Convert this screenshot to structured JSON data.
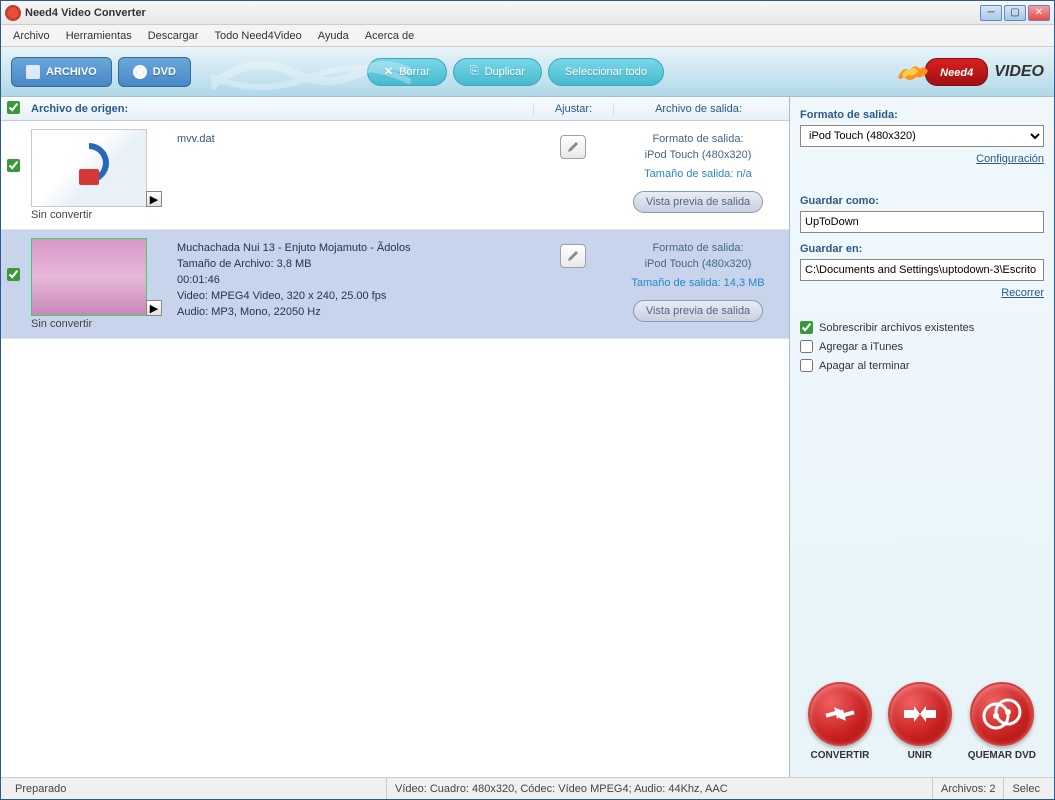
{
  "title": "Need4 Video Converter",
  "menu": [
    "Archivo",
    "Herramientas",
    "Descargar",
    "Todo Need4Video",
    "Ayuda",
    "Acerca de"
  ],
  "toolbar": {
    "archivo": "ARCHIVO",
    "dvd": "DVD",
    "borrar": "Borrar",
    "duplicar": "Duplicar",
    "select_all": "Seleccionar todo",
    "logo1": "Need4",
    "logo2": "VIDEO"
  },
  "list_header": {
    "source": "Archivo de origen:",
    "adjust": "Ajustar:",
    "output": "Archivo de salida:"
  },
  "files": [
    {
      "name": "mvv.dat",
      "status": "Sin convertir",
      "out_fmt_label": "Formato de salida:",
      "out_fmt": "iPod Touch (480x320)",
      "out_size_label": "Tamaño de salida: n/a",
      "preview": "Vista previa de salida"
    },
    {
      "name": "Muchachada Nui 13 - Enjuto Mojamuto - Ã­dolos",
      "status": "Sin convertir",
      "size_line": "Tamaño de Archivo: 3,8 MB",
      "duration": "00:01:46",
      "video_line": "Video: MPEG4 Video, 320 x 240, 25.00 fps",
      "audio_line": "Audio: MP3, Mono, 22050 Hz",
      "out_fmt_label": "Formato de salida:",
      "out_fmt": "iPod Touch (480x320)",
      "out_size_label": "Tamaño de salida: 14,3 MB",
      "preview": "Vista previa de salida"
    }
  ],
  "right": {
    "format_label": "Formato de salida:",
    "format_value": "iPod Touch (480x320)",
    "config": "Configuración",
    "save_as_label": "Guardar como:",
    "save_as_value": "UpToDown",
    "save_in_label": "Guardar en:",
    "save_in_value": "C:\\Documents and Settings\\uptodown-3\\Escrito",
    "browse": "Recorrer",
    "overwrite": "Sobrescribir archivos existentes",
    "itunes": "Agregar a iTunes",
    "shutdown": "Apagar al terminar"
  },
  "actions": {
    "convert": "CONVERTIR",
    "join": "UNIR",
    "burn": "QUEMAR DVD"
  },
  "status": {
    "ready": "Preparado",
    "video": "Vídeo: Cuadro: 480x320, Códec: Vídeo MPEG4; Audio: 44Khz, AAC",
    "files": "Archivos: 2",
    "selec": "Selec"
  }
}
